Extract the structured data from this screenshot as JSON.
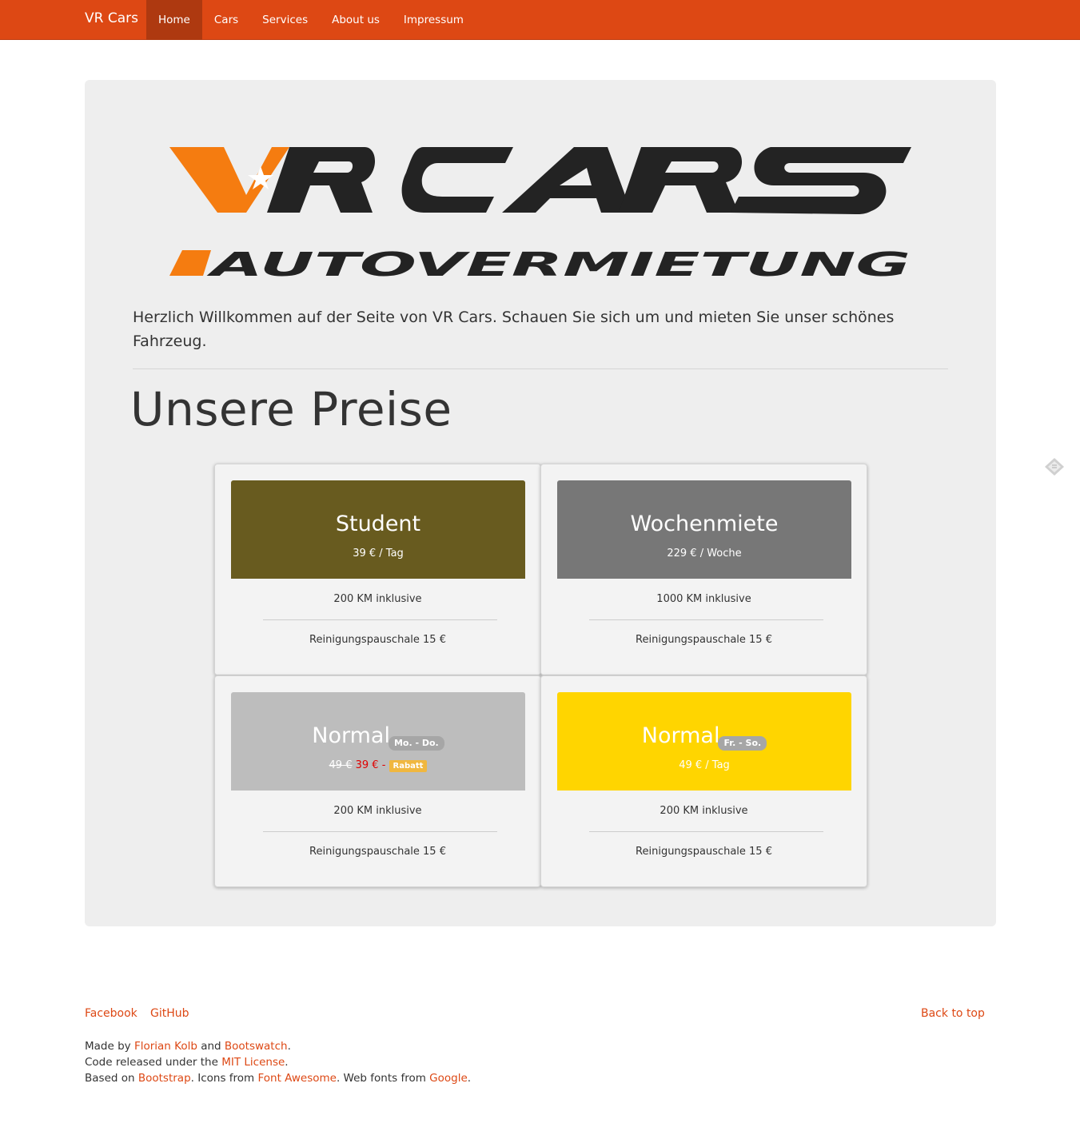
{
  "navbar": {
    "brand": "VR Cars",
    "items": [
      {
        "label": "Home",
        "active": true
      },
      {
        "label": "Cars",
        "active": false
      },
      {
        "label": "Services",
        "active": false
      },
      {
        "label": "About us",
        "active": false
      },
      {
        "label": "Impressum",
        "active": false
      }
    ],
    "color": "#dd4814",
    "active_color": "#ae3910"
  },
  "hero": {
    "logo": {
      "main": "VR CARS",
      "sub": "AUTOVERMIETUNG",
      "accent_color": "#f57c10",
      "dark_color": "#232323"
    },
    "welcome_line1": "Herzlich Willkommen auf der Seite von VR Cars. Schauen Sie sich um und mieten Sie unser schönes",
    "welcome_line2": "Fahrzeug.",
    "heading": "Unsere Preise"
  },
  "pricing": [
    {
      "title": "Student",
      "price": "39 € / Tag",
      "header_color": "#685b1f",
      "features": [
        "200 KM inklusive",
        "Reinigungspauschale 15 €"
      ]
    },
    {
      "title": "Wochenmiete",
      "price": "229 € / Woche",
      "header_color": "#777777",
      "features": [
        "1000 KM inklusive",
        "Reinigungspauschale 15 €"
      ]
    },
    {
      "title": "Normal",
      "badge": "Mo. - Do.",
      "old_price": "49 €",
      "new_price": "39 € -",
      "discount_label": "Rabatt",
      "header_color": "#bdbdbd",
      "features": [
        "200 KM inklusive",
        "Reinigungspauschale 15 €"
      ]
    },
    {
      "title": "Normal",
      "badge": "Fr. - So.",
      "price": "49 € / Tag",
      "header_color": "#ffd500",
      "features": [
        "200 KM inklusive",
        "Reinigungspauschale 15 €"
      ]
    }
  ],
  "side_icon": "tag-icon",
  "footer": {
    "links": [
      "Facebook",
      "GitHub"
    ],
    "back_to_top": "Back to top",
    "made_by": {
      "prefix": "Made by ",
      "author": "Florian Kolb",
      "and": " and ",
      "theme": "Bootswatch",
      "end": "."
    },
    "license": {
      "prefix": "Code released under the ",
      "name": "MIT License",
      "end": "."
    },
    "based": {
      "prefix": "Based on ",
      "bootstrap": "Bootstrap",
      "icons_text": ". Icons from ",
      "fontawesome": "Font Awesome",
      "fonts_text": ". Web fonts from ",
      "google": "Google",
      "end": "."
    },
    "link_color": "#dd4814"
  }
}
